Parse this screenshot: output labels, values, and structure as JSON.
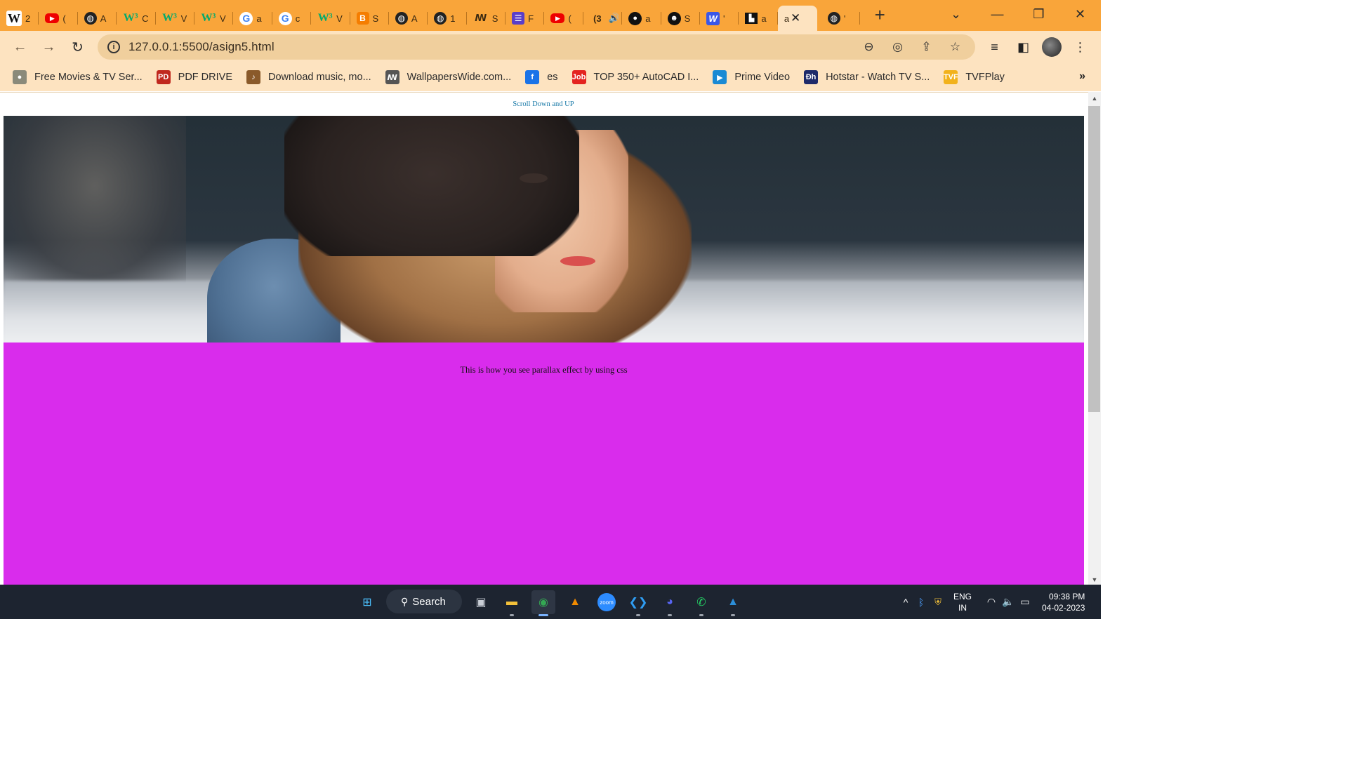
{
  "browser": {
    "tabs": [
      {
        "favicon": "wikipedia-icon",
        "glyph": "W",
        "label": "2",
        "style": "f-w"
      },
      {
        "favicon": "youtube-icon",
        "glyph": "▶",
        "label": "(",
        "style": "f-yt"
      },
      {
        "favicon": "globe-icon",
        "glyph": "◍",
        "label": "A",
        "style": "f-globe"
      },
      {
        "favicon": "w3schools-icon",
        "glyph": "W³",
        "label": "C",
        "style": "f-w3"
      },
      {
        "favicon": "w3schools-icon",
        "glyph": "W³",
        "label": "V",
        "style": "f-w3"
      },
      {
        "favicon": "w3schools-icon",
        "glyph": "W³",
        "label": "V",
        "style": "f-w3"
      },
      {
        "favicon": "google-icon",
        "glyph": "G",
        "label": "a",
        "style": "f-g"
      },
      {
        "favicon": "google-icon",
        "glyph": "G",
        "label": "c",
        "style": "f-g"
      },
      {
        "favicon": "w3schools-icon",
        "glyph": "W³",
        "label": "V",
        "style": "f-w3"
      },
      {
        "favicon": "blogger-icon",
        "glyph": "B",
        "label": "S",
        "style": "f-b"
      },
      {
        "favicon": "globe-icon",
        "glyph": "◍",
        "label": "A",
        "style": "f-globe"
      },
      {
        "favicon": "globe-icon",
        "glyph": "◍",
        "label": "1",
        "style": "f-globe"
      },
      {
        "favicon": "wallpaperswide-icon",
        "glyph": "ꟿ",
        "label": "S",
        "style": ""
      },
      {
        "favicon": "list-icon",
        "glyph": "☰",
        "label": "F",
        "style": "f-list"
      },
      {
        "favicon": "youtube-icon",
        "glyph": "▶",
        "label": "(",
        "style": "f-yt"
      },
      {
        "favicon": "audio-playing-icon",
        "glyph": "(3",
        "label": "🔊",
        "style": ""
      },
      {
        "favicon": "github-icon",
        "glyph": "●",
        "label": "a",
        "style": "f-gh"
      },
      {
        "favicon": "person-icon",
        "glyph": "☻",
        "label": "S",
        "style": "f-gh"
      },
      {
        "favicon": "webflow-icon",
        "glyph": "W",
        "label": "'",
        "style": "f-wb"
      },
      {
        "favicon": "unsplash-icon",
        "glyph": "▙",
        "label": "a",
        "style": "f-un"
      }
    ],
    "active_tab": {
      "label": "a",
      "close": "✕"
    },
    "extra_tab": {
      "favicon": "globe-icon",
      "glyph": "◍",
      "label": "'"
    },
    "new_tab": "+",
    "window_controls": {
      "tab_search": "⌄",
      "minimize": "—",
      "restore": "❐",
      "close": "✕"
    },
    "nav": {
      "back": "←",
      "forward": "→",
      "reload": "↻"
    },
    "address": {
      "url": "127.0.0.1:5500/asign5.html",
      "info": "i"
    },
    "omni_icons": {
      "zoom": "⊖",
      "eye_off": "◎",
      "share": "⇪",
      "star": "☆"
    },
    "toolbar_icons": {
      "media": "≡",
      "sidepanel": "◧",
      "menu": "⋮"
    },
    "bookmarks": [
      {
        "icon": "free-movies-icon",
        "glyph": "●",
        "label": "Free Movies & TV Ser...",
        "color": "#8a8a7a"
      },
      {
        "icon": "pdf-drive-icon",
        "glyph": "PD",
        "label": "PDF DRIVE",
        "color": "#c0281e"
      },
      {
        "icon": "download-music-icon",
        "glyph": "♪",
        "label": "Download music, mo...",
        "color": "#8a5a2a"
      },
      {
        "icon": "wallpaperswide-icon",
        "glyph": "ꟿ",
        "label": "WallpapersWide.com...",
        "color": "#555"
      },
      {
        "icon": "es-icon",
        "glyph": "f",
        "label": "es",
        "color": "#1a73e8"
      },
      {
        "icon": "job-icon",
        "glyph": "Job",
        "label": "TOP 350+ AutoCAD I...",
        "color": "#e4231f"
      },
      {
        "icon": "prime-video-icon",
        "glyph": "▶",
        "label": "Prime Video",
        "color": "#1a8ad4"
      },
      {
        "icon": "hotstar-icon",
        "glyph": "Đh",
        "label": "Hotstar - Watch TV S...",
        "color": "#1e2a6a"
      },
      {
        "icon": "tvfplay-icon",
        "glyph": "TVF",
        "label": "TVFPlay",
        "color": "#f2b21c"
      }
    ],
    "bookmarks_more": "»"
  },
  "page": {
    "scroll_hint": "Scroll Down and UP",
    "parallax_text": "This is how you see parallax effect by using css",
    "section_color": "#d92cec",
    "hero_image": "woman-in-beanie-photo"
  },
  "taskbar": {
    "search_label": "Search",
    "apps": [
      {
        "name": "windows-start-icon",
        "glyph": "⊞",
        "color": "#4cc2ff"
      },
      {
        "name": "task-view-icon",
        "glyph": "▣",
        "color": "#c9ced6"
      },
      {
        "name": "file-explorer-icon",
        "glyph": "▬",
        "color": "#f3c13a"
      },
      {
        "name": "chrome-icon",
        "glyph": "◉",
        "color": "#34a853"
      },
      {
        "name": "vlc-icon",
        "glyph": "▲",
        "color": "#f08a00"
      },
      {
        "name": "zoom-icon",
        "glyph": "zoom",
        "color": "#2d8cff"
      },
      {
        "name": "vscode-icon",
        "glyph": "❮❯",
        "color": "#2f9ef4"
      },
      {
        "name": "discord-icon",
        "glyph": "◕",
        "color": "#5865f2"
      },
      {
        "name": "whatsapp-icon",
        "glyph": "✆",
        "color": "#25d366"
      },
      {
        "name": "photos-icon",
        "glyph": "▲",
        "color": "#2c8ed8"
      }
    ],
    "tray": {
      "chevron": "^",
      "lang_top": "ENG",
      "lang_bottom": "IN",
      "time": "09:38 PM",
      "date": "04-02-2023"
    }
  }
}
